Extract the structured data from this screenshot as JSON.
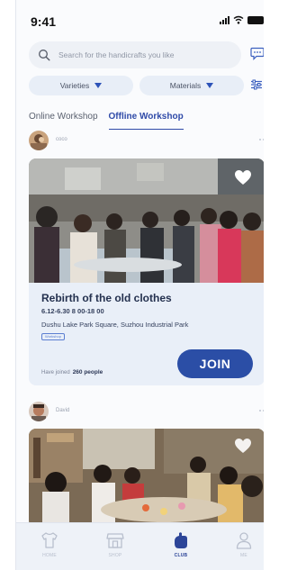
{
  "status_bar": {
    "time": "9:41"
  },
  "search": {
    "placeholder": "Search for the handicrafts you like"
  },
  "filters": {
    "varieties": "Varieties",
    "materials": "Materials"
  },
  "tabs": [
    {
      "label": "Online Workshop",
      "active": false
    },
    {
      "label": "Offline Workshop",
      "active": true
    }
  ],
  "posts": [
    {
      "author": "coco",
      "title": "Rebirth of the old clothes",
      "date": "6.12-6.30  8   00-18   00",
      "location": "Dushu Lake Park Square, Suzhou Industrial Park",
      "tag": "Workshop",
      "joined_label": "Have joined",
      "joined_count": "260 people",
      "join_button": "JOIN"
    },
    {
      "author": "David"
    }
  ],
  "bottom_nav": [
    {
      "label": "HOME",
      "icon": "shirt-icon",
      "active": false
    },
    {
      "label": "SHOP",
      "icon": "shop-icon",
      "active": false
    },
    {
      "label": "CLUB",
      "icon": "club-hand-icon",
      "active": true
    },
    {
      "label": "ME",
      "icon": "person-icon",
      "active": false
    }
  ],
  "colors": {
    "accent": "#2b4ea6",
    "card_bg": "#e9eff8",
    "pill_bg": "#e8eef7"
  }
}
